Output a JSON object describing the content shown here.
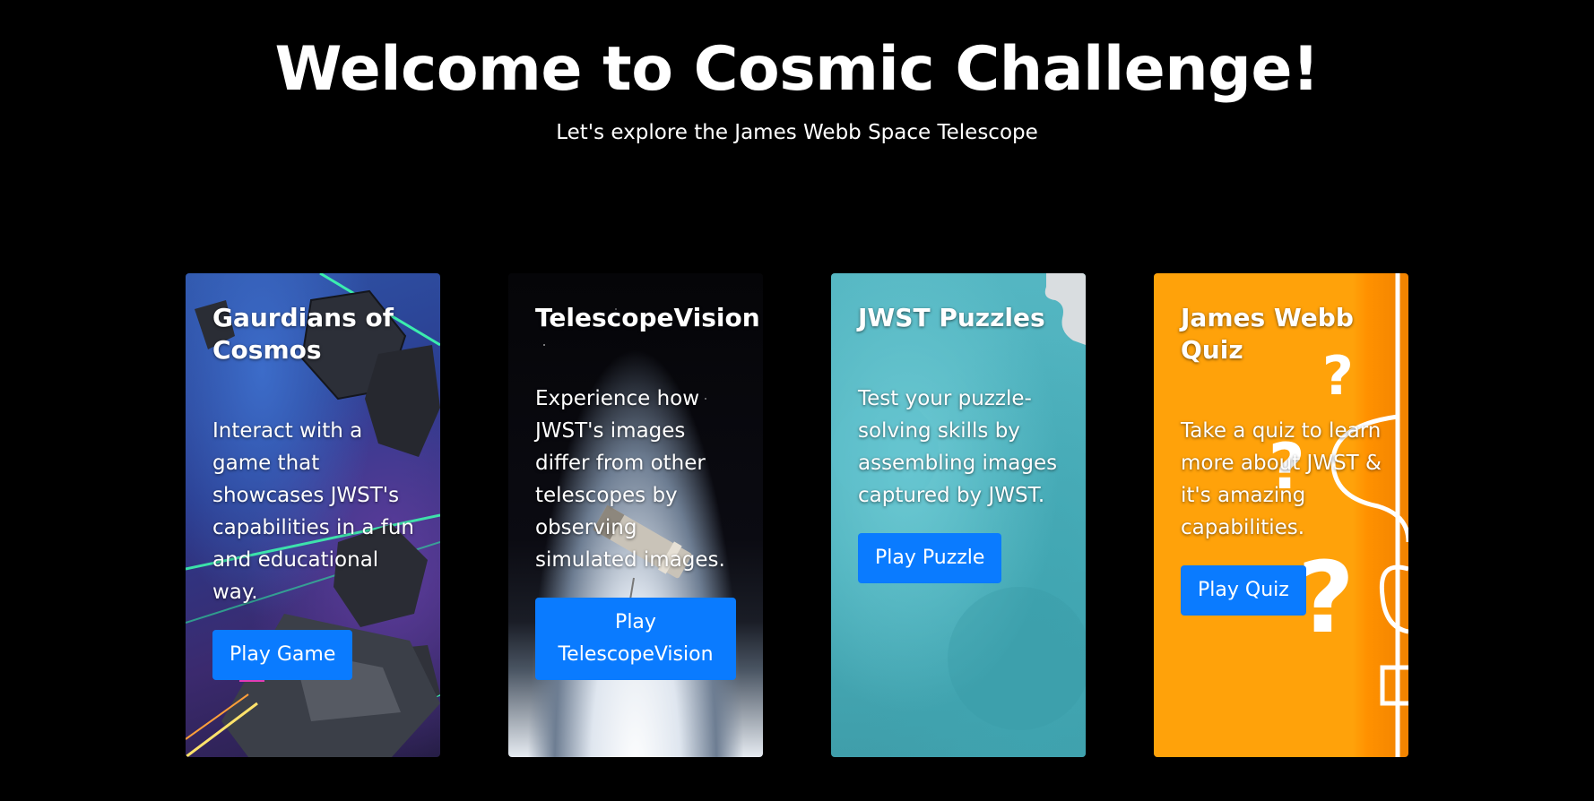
{
  "header": {
    "title": "Welcome to Cosmic Challenge!",
    "subtitle": "Let's explore the James Webb Space Telescope"
  },
  "cards": [
    {
      "title": "Gaurdians of Cosmos",
      "description": "Interact with a game that showcases JWST's capabilities in a fun and educational way.",
      "button": "Play Game"
    },
    {
      "title": "TelescopeVision",
      "description": "Experience how JWST's images differ from other telescopes by observing simulated images.",
      "button": "Play TelescopeVision"
    },
    {
      "title": "JWST Puzzles",
      "description": "Test your puzzle-solving skills by assembling images captured by JWST.",
      "button": "Play Puzzle"
    },
    {
      "title": "James Webb Quiz",
      "description": "Take a quiz to learn more about JWST & it's amazing capabilities.",
      "button": "Play Quiz"
    }
  ],
  "colors": {
    "background": "#000000",
    "button": "#0a7bff",
    "quiz_card": "#ffa20a",
    "puzzle_card": "#4fb2be"
  }
}
